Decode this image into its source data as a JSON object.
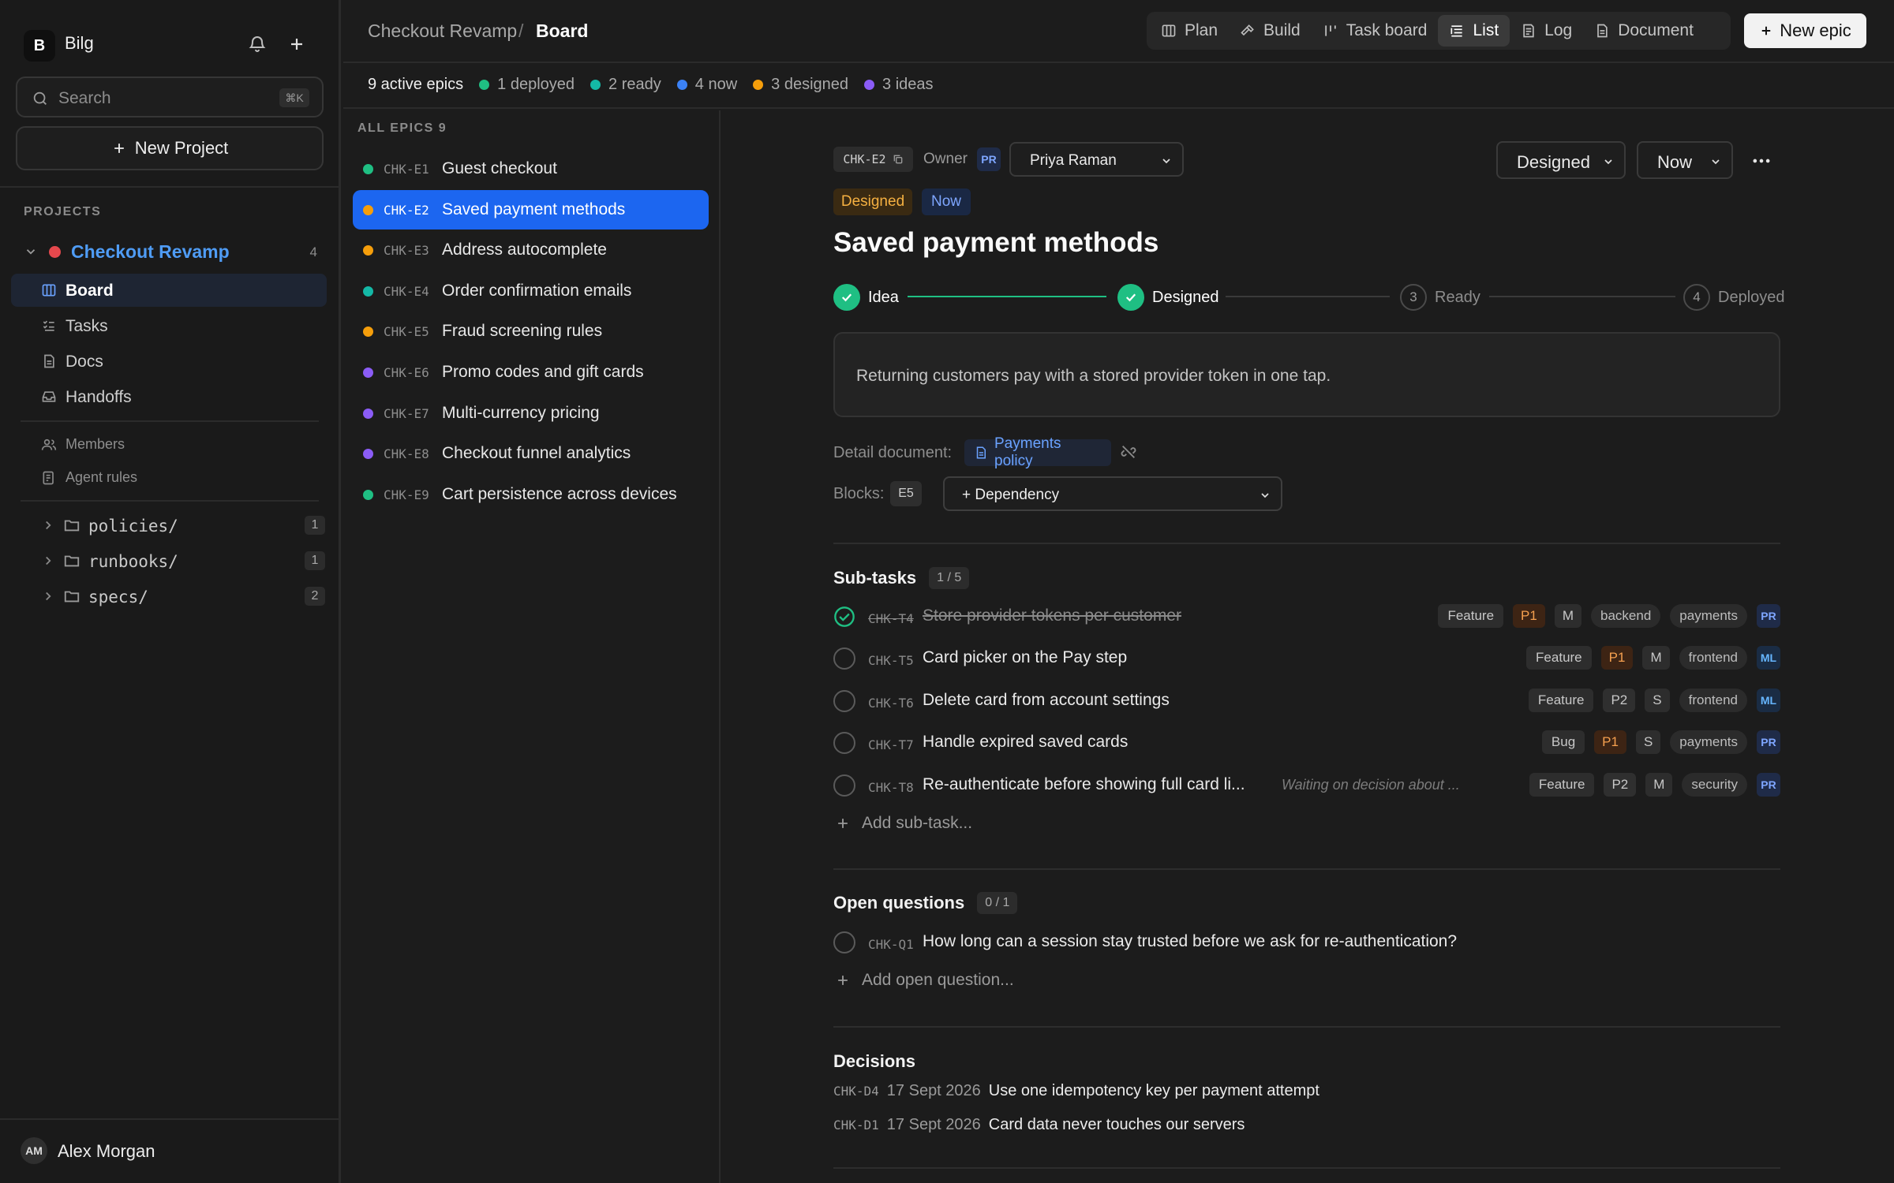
{
  "workspace": {
    "initial": "B",
    "name": "Bilg"
  },
  "search": {
    "placeholder": "Search",
    "shortcut": "⌘K"
  },
  "sidebar": {
    "new_project": "New Project",
    "projects_label": "PROJECTS",
    "project": {
      "name": "Checkout Revamp",
      "count": "4",
      "color": "#e5484d"
    },
    "nav": [
      {
        "label": "Board",
        "icon": "board-icon",
        "active": true
      },
      {
        "label": "Tasks",
        "icon": "tasks-icon"
      },
      {
        "label": "Docs",
        "icon": "docs-icon"
      },
      {
        "label": "Handoffs",
        "icon": "handoffs-icon"
      }
    ],
    "secondary": [
      {
        "label": "Members",
        "icon": "members-icon"
      },
      {
        "label": "Agent rules",
        "icon": "agent-rules-icon"
      }
    ],
    "folders": [
      {
        "name": "policies/",
        "count": "1"
      },
      {
        "name": "runbooks/",
        "count": "1"
      },
      {
        "name": "specs/",
        "count": "2"
      }
    ],
    "user": {
      "initials": "AM",
      "name": "Alex Morgan"
    }
  },
  "header": {
    "breadcrumb": [
      "Checkout Revamp",
      "/",
      "Board"
    ],
    "tabs": [
      {
        "label": "Plan",
        "icon": "plan-icon"
      },
      {
        "label": "Build",
        "icon": "build-icon"
      },
      {
        "label": "Task board",
        "icon": "task-board-icon"
      },
      {
        "label": "List",
        "icon": "list-icon",
        "active": true
      },
      {
        "label": "Log",
        "icon": "log-icon"
      },
      {
        "label": "Document",
        "icon": "document-icon"
      }
    ],
    "new_epic": "New epic"
  },
  "status_strip": {
    "total": "9 active epics",
    "items": [
      {
        "label": "1 deployed",
        "color": "#1fbf83"
      },
      {
        "label": "2 ready",
        "color": "#14b8a6"
      },
      {
        "label": "4 now",
        "color": "#3b82f6"
      },
      {
        "label": "3 designed",
        "color": "#f59e0b"
      },
      {
        "label": "3 ideas",
        "color": "#8b5cf6"
      }
    ]
  },
  "epic_list": {
    "header": "ALL EPICS 9",
    "items": [
      {
        "id": "CHK-E1",
        "title": "Guest checkout",
        "color": "#1fbf83"
      },
      {
        "id": "CHK-E2",
        "title": "Saved payment methods",
        "color": "#f59e0b",
        "selected": true
      },
      {
        "id": "CHK-E3",
        "title": "Address autocomplete",
        "color": "#f59e0b"
      },
      {
        "id": "CHK-E4",
        "title": "Order confirmation emails",
        "color": "#14b8a6"
      },
      {
        "id": "CHK-E5",
        "title": "Fraud screening rules",
        "color": "#f59e0b"
      },
      {
        "id": "CHK-E6",
        "title": "Promo codes and gift cards",
        "color": "#8b5cf6"
      },
      {
        "id": "CHK-E7",
        "title": "Multi-currency pricing",
        "color": "#8b5cf6"
      },
      {
        "id": "CHK-E8",
        "title": "Checkout funnel analytics",
        "color": "#8b5cf6"
      },
      {
        "id": "CHK-E9",
        "title": "Cart persistence across devices",
        "color": "#1fbf83"
      }
    ]
  },
  "detail": {
    "id": "CHK-E2",
    "owner_label": "Owner",
    "owner_initials": "PR",
    "owner_name": "Priya Raman",
    "status_select": "Designed",
    "timing_select": "Now",
    "tags": [
      "Designed",
      "Now"
    ],
    "title": "Saved payment methods",
    "steps": [
      {
        "label": "Idea",
        "num": "1",
        "done": true
      },
      {
        "label": "Designed",
        "num": "2",
        "done": true
      },
      {
        "label": "Ready",
        "num": "3",
        "done": false
      },
      {
        "label": "Deployed",
        "num": "4",
        "done": false
      }
    ],
    "description": "Returning customers pay with a stored provider token in one tap.",
    "detail_doc_label": "Detail document:",
    "detail_doc": "Payments policy",
    "blocks_label": "Blocks:",
    "blocks": "E5",
    "dependency": "+ Dependency",
    "subtasks": {
      "title": "Sub-tasks",
      "count": "1 / 5",
      "items": [
        {
          "id": "CHK-T4",
          "title": "Store provider tokens per customer",
          "done": true,
          "type": "Feature",
          "priority": "P1",
          "size": "M",
          "label": "backend",
          "tag": "payments",
          "owner": "PR"
        },
        {
          "id": "CHK-T5",
          "title": "Card picker on the Pay step",
          "type": "Feature",
          "priority": "P1",
          "size": "M",
          "label": "frontend",
          "owner": "ML"
        },
        {
          "id": "CHK-T6",
          "title": "Delete card from account settings",
          "type": "Feature",
          "priority": "P2",
          "size": "S",
          "label": "frontend",
          "owner": "ML"
        },
        {
          "id": "CHK-T7",
          "title": "Handle expired saved cards",
          "type": "Bug",
          "priority": "P1",
          "size": "S",
          "label": "payments",
          "owner": "PR"
        },
        {
          "id": "CHK-T8",
          "title": "Re-authenticate before showing full card li...",
          "note": "Waiting on decision about ...",
          "type": "Feature",
          "priority": "P2",
          "size": "M",
          "label": "security",
          "owner": "PR"
        }
      ],
      "add": "Add sub-task..."
    },
    "questions": {
      "title": "Open questions",
      "count": "0 / 1",
      "items": [
        {
          "id": "CHK-Q1",
          "title": "How long can a session stay trusted before we ask for re-authentication?"
        }
      ],
      "add": "Add open question..."
    },
    "decisions": {
      "title": "Decisions",
      "items": [
        {
          "id": "CHK-D4",
          "date": "17 Sept 2026",
          "title": "Use one idempotency key per payment attempt"
        },
        {
          "id": "CHK-D1",
          "date": "17 Sept 2026",
          "title": "Card data never touches our servers"
        }
      ]
    }
  }
}
